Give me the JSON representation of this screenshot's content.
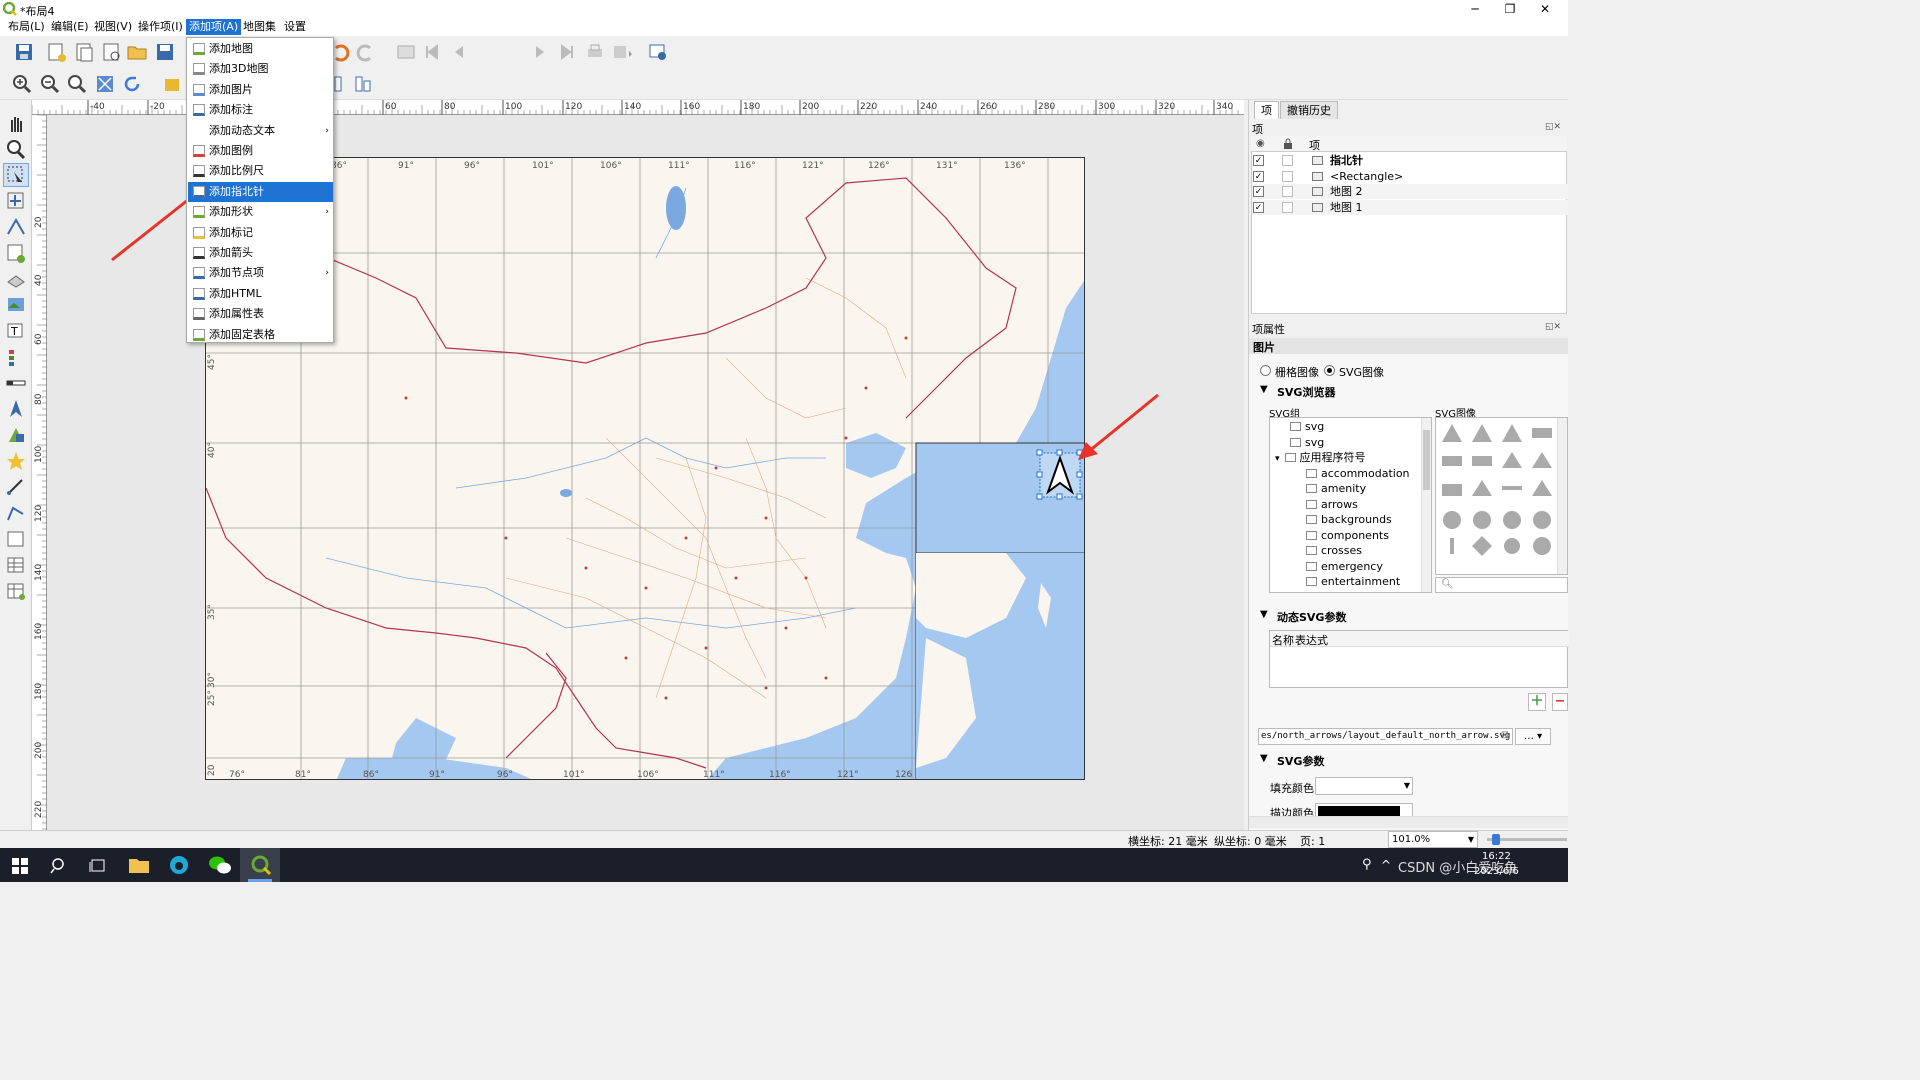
{
  "window": {
    "title": "*布局4",
    "minimize": "─",
    "restore": "❐",
    "close": "✕"
  },
  "menu": {
    "items": [
      "布局(L)",
      "编辑(E)",
      "视图(V)",
      "操作项(I)",
      "添加项(A)",
      "地图集",
      "设置"
    ],
    "active_index": 4
  },
  "toolbar": {
    "page_value": "1"
  },
  "dropdown": {
    "items": [
      {
        "label": "添加地图",
        "submenu": false
      },
      {
        "label": "添加3D地图",
        "submenu": false
      },
      {
        "label": "添加图片",
        "submenu": false
      },
      {
        "label": "添加标注",
        "submenu": false
      },
      {
        "label": "添加动态文本",
        "submenu": true
      },
      {
        "label": "添加图例",
        "submenu": false
      },
      {
        "label": "添加比例尺",
        "submenu": false
      },
      {
        "label": "添加指北针",
        "submenu": false
      },
      {
        "label": "添加形状",
        "submenu": true
      },
      {
        "label": "添加标记",
        "submenu": false
      },
      {
        "label": "添加箭头",
        "submenu": false
      },
      {
        "label": "添加节点项",
        "submenu": true
      },
      {
        "label": "添加HTML",
        "submenu": false
      },
      {
        "label": "添加属性表",
        "submenu": false
      },
      {
        "label": "添加固定表格",
        "submenu": false
      }
    ],
    "highlight_index": 7,
    "submenu_arrow": "›"
  },
  "ruler": {
    "h_ticks": [
      "-40",
      "-20",
      "60",
      "80",
      "100",
      "120",
      "140",
      "160",
      "180",
      "200",
      "220",
      "240",
      "260",
      "280",
      "300",
      "320",
      "340"
    ],
    "v_ticks": [
      "20",
      "40",
      "60",
      "80",
      "100",
      "120",
      "140",
      "160",
      "180",
      "200",
      "220"
    ]
  },
  "map": {
    "top_lon_labels": [
      "86°",
      "91°",
      "96°",
      "101°",
      "106°",
      "111°",
      "116°",
      "121°",
      "126°",
      "131°",
      "136°"
    ],
    "bottom_lon_labels": [
      "76°",
      "81°",
      "86°",
      "91°",
      "96°",
      "101°",
      "106°",
      "111°",
      "116°",
      "121°",
      "126"
    ],
    "left_lat_labels": [
      "45°",
      "40°",
      "35°",
      "30°",
      "25°",
      "20"
    ],
    "colors": {
      "land": "#faf6ef",
      "sea": "#a5c8f0",
      "border": "#b5334f",
      "road": "#e8a68a",
      "grid": "#9a9a9a"
    }
  },
  "right_panel": {
    "tabs": [
      "项",
      "撤销历史"
    ],
    "items_header": "项",
    "items_col": "项",
    "items": [
      {
        "name": "指北针",
        "checked": true,
        "bold": true
      },
      {
        "name": "<Rectangle>",
        "checked": true,
        "bold": false
      },
      {
        "name": "地图 2",
        "checked": true,
        "bold": false
      },
      {
        "name": "地图 1",
        "checked": true,
        "bold": false
      }
    ],
    "props_header": "项属性",
    "props_title": "图片",
    "radio_raster": "栅格图像",
    "radio_svg": "SVG图像",
    "svg_browser": "SVG浏览器",
    "svg_group_label": "SVG组",
    "svg_image_label": "SVG图像",
    "tree": [
      {
        "label": "svg",
        "indent": 1
      },
      {
        "label": "svg",
        "indent": 1
      },
      {
        "label": "应用程序符号",
        "indent": 0,
        "expander": "▾"
      },
      {
        "label": "accommodation",
        "indent": 2
      },
      {
        "label": "amenity",
        "indent": 2
      },
      {
        "label": "arrows",
        "indent": 2
      },
      {
        "label": "backgrounds",
        "indent": 2
      },
      {
        "label": "components",
        "indent": 2
      },
      {
        "label": "crosses",
        "indent": 2
      },
      {
        "label": "emergency",
        "indent": 2
      },
      {
        "label": "entertainment",
        "indent": 2
      }
    ],
    "dynamic_svg": "动态SVG参数",
    "param_col1": "名称",
    "param_col2": "表达式",
    "svg_path": "es/north_arrows/layout_default_north_arrow.svg",
    "svg_params": "SVG参数",
    "fill_color_label": "填充颜色",
    "stroke_color_label": "描边颜色"
  },
  "status": {
    "x_coord": "横坐标: 21 毫米",
    "y_coord": "纵坐标: 0 毫米",
    "page": "页: 1",
    "zoom": "101.0%"
  },
  "taskbar": {
    "time": "16:22",
    "date": "2023/6/6",
    "watermark": "CSDN @小白爱吃鱼"
  }
}
